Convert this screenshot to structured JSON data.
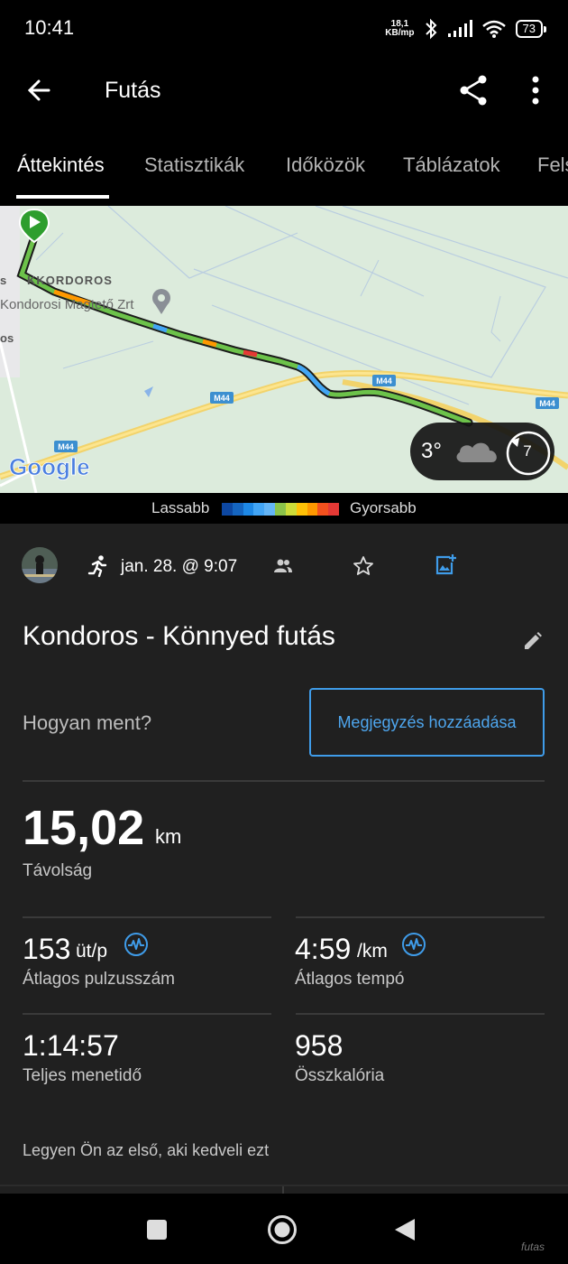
{
  "status_bar": {
    "time": "10:41",
    "net_speed_value": "18,1",
    "net_speed_unit": "KB/mp",
    "battery": "73",
    "icons": [
      "bluetooth-icon",
      "signal-icon",
      "wifi-icon",
      "battery-icon"
    ]
  },
  "app_bar": {
    "title": "Futás",
    "icons": [
      "back-arrow-icon",
      "share-icon",
      "more-vertical-icon"
    ]
  },
  "tabs": [
    {
      "label": "Áttekintés",
      "active": true
    },
    {
      "label": "Statisztikák",
      "active": false
    },
    {
      "label": "Időközök",
      "active": false
    },
    {
      "label": "Táblázatok",
      "active": false
    },
    {
      "label": "Fels",
      "active": false
    }
  ],
  "map": {
    "labels": {
      "town": "KKORDOROS",
      "poi": "Kondorosi Magtető Zrt",
      "edge_s": "s",
      "edge_os": "os",
      "road1": "M44",
      "road2": "M44",
      "road3": "M44",
      "road4": "M44"
    },
    "provider": "Google",
    "weather": {
      "temperature": "3°",
      "icon": "cloud-icon",
      "wind_speed": "7"
    }
  },
  "pace_legend": {
    "slower": "Lassabb",
    "faster": "Gyorsabb",
    "colors": [
      "#0d47a1",
      "#1565c0",
      "#1e88e5",
      "#42a5f5",
      "#64b5f6",
      "#8bc34a",
      "#cddc39",
      "#ffc107",
      "#ff9800",
      "#f4511e",
      "#e53935"
    ]
  },
  "activity": {
    "date": "jan. 28. @ 9:07",
    "title": "Kondoros - Könnyed futás",
    "feel_prompt": "Hogyan ment?",
    "add_note": "Megjegyzés hozzáadása"
  },
  "stats": {
    "distance": {
      "value": "15,02",
      "unit": "km",
      "label": "Távolság"
    },
    "avg_hr": {
      "value": "153",
      "unit": "üt/p",
      "label": "Átlagos pulzusszám"
    },
    "avg_pace": {
      "value": "4:59",
      "unit": "/km",
      "label": "Átlagos tempó"
    },
    "total_time": {
      "value": "1:14:57",
      "label": "Teljes menetidő"
    },
    "calories": {
      "value": "958",
      "label": "Összkalória"
    }
  },
  "likes_text": "Legyen Ön az első, aki kedveli ezt",
  "watermark": "futas"
}
